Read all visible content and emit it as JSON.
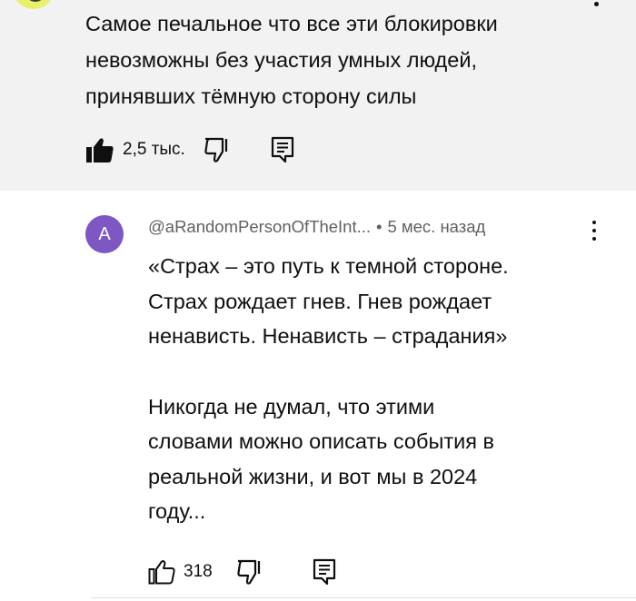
{
  "parent_comment": {
    "lines": [
      "Самое печальное что все эти блокировки",
      "невозможны без участия умных людей,",
      "принявших тёмную сторону силы"
    ],
    "like_count": "2,5 тыс.",
    "icons": {
      "like": "thumbs-up-filled-icon",
      "dislike": "thumbs-down-icon",
      "reply": "reply-icon",
      "menu": "more-vert-icon"
    }
  },
  "reply_comment": {
    "avatar_letter": "A",
    "avatar_color": "#7e57c2",
    "author": "@aRandomPersonOfTheInt...",
    "separator": "•",
    "time": "5 мес. назад",
    "lines": [
      "«Страх – это путь к темной стороне.",
      "Страх рождает гнев. Гнев рождает",
      "ненависть. Ненависть – страдания»"
    ],
    "lines2": [
      "Никогда не думал, что этими",
      "словами можно описать события в",
      "реальной жизни, и вот мы в 2024",
      "году..."
    ],
    "like_count": "318",
    "icons": {
      "like": "thumbs-up-outline-icon",
      "dislike": "thumbs-down-icon",
      "reply": "reply-icon",
      "menu": "more-vert-icon"
    }
  },
  "colors": {
    "parent_background": "#f2f2f2",
    "text": "#0f0f0f",
    "meta_text": "#606060"
  }
}
